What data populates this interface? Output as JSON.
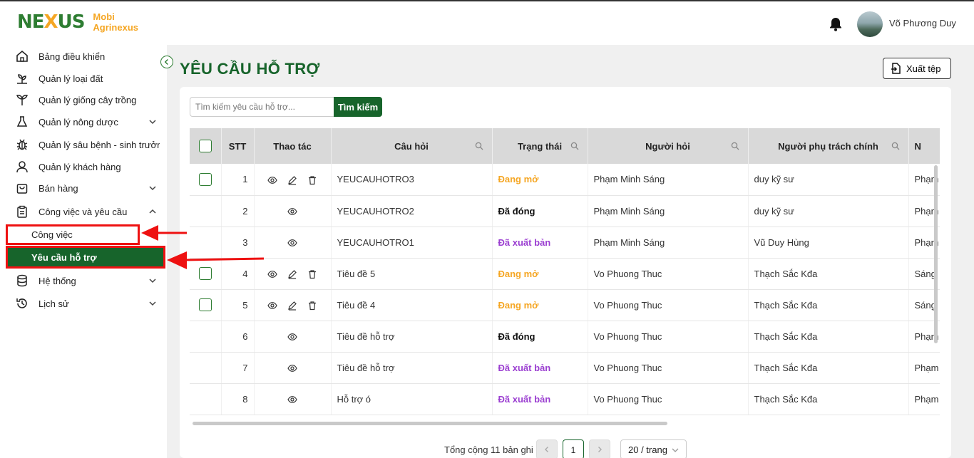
{
  "brand": {
    "mark_left": "NE",
    "mark_x": "X",
    "mark_right": "US",
    "line1": "Mobi",
    "line2": "Agrinexus"
  },
  "user": {
    "name": "Võ Phương Duy"
  },
  "sidebar": {
    "items": [
      {
        "label": "Bảng điều khiển",
        "icon": "home-icon"
      },
      {
        "label": "Quản lý loại đất",
        "icon": "plant-icon"
      },
      {
        "label": "Quản lý giống cây trồng",
        "icon": "tree-icon"
      },
      {
        "label": "Quản lý nông dược",
        "icon": "flask-icon"
      },
      {
        "label": "Quản lý sâu bệnh - sinh trưởng",
        "icon": "bug-icon"
      },
      {
        "label": "Quản lý khách hàng",
        "icon": "user-icon"
      },
      {
        "label": "Bán hàng",
        "icon": "bag-icon"
      },
      {
        "label": "Công việc và yêu cầu",
        "icon": "clipboard-icon"
      },
      {
        "label": "Hệ thống",
        "icon": "database-icon"
      },
      {
        "label": "Lịch sử",
        "icon": "history-icon"
      }
    ],
    "sub_items": [
      {
        "label": "Công việc"
      },
      {
        "label": "Yêu cầu hỗ trợ"
      }
    ]
  },
  "page": {
    "title": "YÊU CẦU HỖ TRỢ",
    "export_label": "Xuất tệp"
  },
  "search": {
    "placeholder": "Tìm kiếm yêu cầu hỗ trợ...",
    "button": "Tìm kiếm"
  },
  "table": {
    "headers": [
      "STT",
      "Thao tác",
      "Câu hỏi",
      "Trạng thái",
      "Người hỏi",
      "Người phụ trách chính",
      "N"
    ],
    "rows": [
      {
        "stt": "1",
        "question": "YEUCAUHOTRO3",
        "status": "Đang mở",
        "asker": "Phạm Minh Sáng",
        "owner": "duy kỹ sư",
        "extra": "Phạm",
        "editable": true
      },
      {
        "stt": "2",
        "question": "YEUCAUHOTRO2",
        "status": "Đã đóng",
        "asker": "Phạm Minh Sáng",
        "owner": "duy kỹ sư",
        "extra": "Phạm",
        "editable": false
      },
      {
        "stt": "3",
        "question": "YEUCAUHOTRO1",
        "status": "Đã xuất bản",
        "asker": "Phạm Minh Sáng",
        "owner": "Vũ Duy Hùng",
        "extra": "Phạm",
        "editable": false
      },
      {
        "stt": "4",
        "question": "Tiêu đề 5",
        "status": "Đang mở",
        "asker": "Vo Phuong Thuc",
        "owner": "Thạch Sắc Kđa",
        "extra": "Sáng",
        "editable": true
      },
      {
        "stt": "5",
        "question": "Tiêu đề 4",
        "status": "Đang mở",
        "asker": "Vo Phuong Thuc",
        "owner": "Thạch Sắc Kđa",
        "extra": "Sáng",
        "editable": true
      },
      {
        "stt": "6",
        "question": "Tiêu đề hỗ trợ",
        "status": "Đã đóng",
        "asker": "Vo Phuong Thuc",
        "owner": "Thạch Sắc Kđa",
        "extra": "Phạm",
        "editable": false
      },
      {
        "stt": "7",
        "question": "Tiêu đề hỗ trợ",
        "status": "Đã xuất bản",
        "asker": "Vo Phuong Thuc",
        "owner": "Thạch Sắc Kđa",
        "extra": "Phạm",
        "editable": false
      },
      {
        "stt": "8",
        "question": "Hỗ trợ ó",
        "status": "Đã xuất bản",
        "asker": "Vo Phuong Thuc",
        "owner": "Thạch Sắc Kđa",
        "extra": "Phạm",
        "editable": false
      }
    ]
  },
  "pagination": {
    "total": "Tổng cộng 11 bản ghi",
    "current_page": "1",
    "page_size": "20 / trang"
  },
  "colors": {
    "primary": "#17642b",
    "open": "#f5a623",
    "published": "#9b3fd1",
    "highlight": "#e11111"
  }
}
